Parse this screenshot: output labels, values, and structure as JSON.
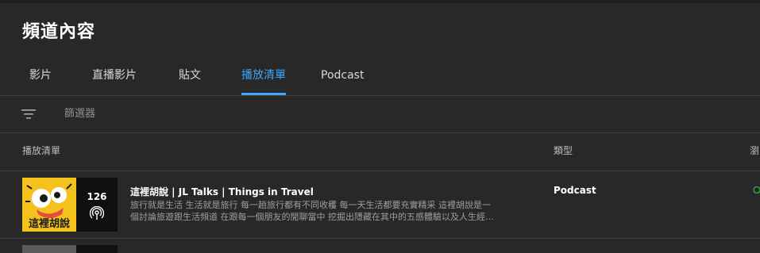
{
  "page": {
    "title": "頻道內容"
  },
  "tabs": [
    {
      "label": "影片",
      "active": false
    },
    {
      "label": "直播影片",
      "active": false
    },
    {
      "label": "貼文",
      "active": false
    },
    {
      "label": "播放清單",
      "active": true
    },
    {
      "label": "Podcast",
      "active": false
    }
  ],
  "filter": {
    "placeholder": "篩選器",
    "icon": "filter-icon"
  },
  "table": {
    "columns": {
      "playlist": "播放清單",
      "type": "類型",
      "visibility": "瀏"
    },
    "rows": [
      {
        "title": "這裡胡說 | JL Talks | Things in Travel",
        "description_line1": "旅行就是生活 生活就是旅行 每一趟旅行都有不同收穫 每一天生活都要充實精采 這裡胡說是一",
        "description_line2": "個討論旅遊跟生活頻道 在跟每一個朋友的閒聊當中 挖掘出隱藏在其中的五感體驗以及人生經…",
        "type": "Podcast",
        "video_count": "126",
        "thumbnail_text": "這裡胡說",
        "icon": "podcast-icon"
      }
    ]
  },
  "colors": {
    "background": "#282828",
    "accent": "#3ea6ff",
    "thumbnail_yellow": "#f4c21d",
    "status_green": "#2ba640"
  }
}
